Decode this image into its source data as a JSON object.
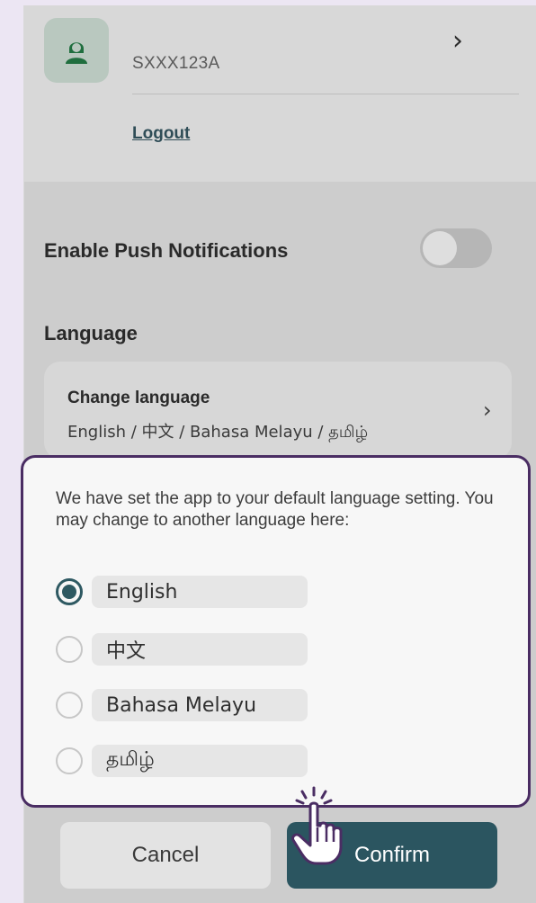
{
  "profile": {
    "user_id": "SXXX123A",
    "logout_label": "Logout"
  },
  "settings": {
    "push_label": "Enable Push Notifications",
    "push_enabled": false,
    "language_heading": "Language",
    "change_language_title": "Change language",
    "change_language_value": "English / 中文 / Bahasa Melayu / தமிழ்"
  },
  "dialog": {
    "message": "We have set the app to your default language setting. You may change to another language here:",
    "options": [
      {
        "label": "English",
        "selected": true
      },
      {
        "label": "中文",
        "selected": false
      },
      {
        "label": "Bahasa Melayu",
        "selected": false
      },
      {
        "label": "தமிழ்",
        "selected": false
      }
    ],
    "cancel_label": "Cancel",
    "confirm_label": "Confirm"
  },
  "colors": {
    "accent": "#2b5560",
    "highlight_border": "#4a2d63",
    "page_background": "#ece6f3"
  },
  "icons": {
    "avatar": "person-avatar-icon",
    "chevron": "chevron-right-icon",
    "pointer": "hand-pointer-icon"
  }
}
